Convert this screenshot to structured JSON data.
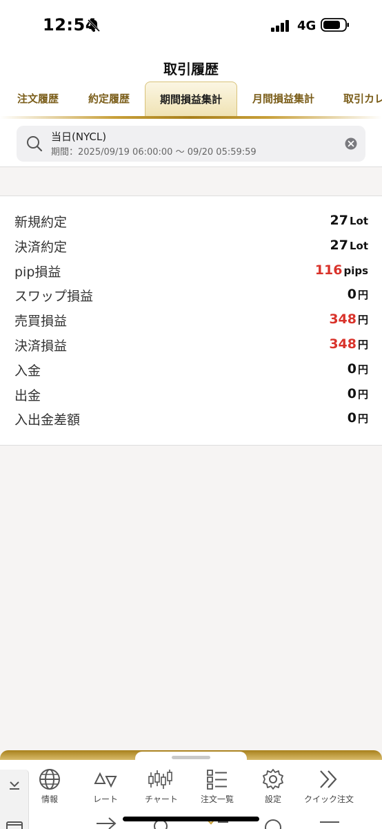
{
  "status_bar": {
    "time": "12:54",
    "network": "4G"
  },
  "header": {
    "title": "取引履歴",
    "tabs": [
      {
        "label": "注文履歴"
      },
      {
        "label": "約定履歴"
      },
      {
        "label": "期間損益集計"
      },
      {
        "label": "月間損益集計"
      },
      {
        "label": "取引カレ"
      }
    ],
    "active_tab": "期間損益集計"
  },
  "search": {
    "title": "当日(NYCL)",
    "period": "期間：2025/09/19 06:00:00 ～ 09/20 05:59:59"
  },
  "summary": {
    "rows": [
      {
        "label": "新規約定",
        "value": "27",
        "unit": "Lot",
        "highlight": false
      },
      {
        "label": "決済約定",
        "value": "27",
        "unit": "Lot",
        "highlight": false
      },
      {
        "label": "pip損益",
        "value": "116",
        "unit": "pips",
        "highlight": true
      },
      {
        "label": "スワップ損益",
        "value": "0",
        "unit": "円",
        "highlight": false
      },
      {
        "label": "売買損益",
        "value": "348",
        "unit": "円",
        "highlight": true
      },
      {
        "label": "決済損益",
        "value": "348",
        "unit": "円",
        "highlight": true
      },
      {
        "label": "入金",
        "value": "0",
        "unit": "円",
        "highlight": false
      },
      {
        "label": "出金",
        "value": "0",
        "unit": "円",
        "highlight": false
      },
      {
        "label": "入出金差額",
        "value": "0",
        "unit": "円",
        "highlight": false
      }
    ]
  },
  "bottom_nav": {
    "items": [
      {
        "label": "情報",
        "icon": "globe-icon"
      },
      {
        "label": "レート",
        "icon": "rate-triangles-icon"
      },
      {
        "label": "チャート",
        "icon": "candlestick-icon"
      },
      {
        "label": "注文一覧",
        "icon": "order-list-icon"
      },
      {
        "label": "設定",
        "icon": "gear-icon"
      },
      {
        "label": "クイック注文",
        "icon": "double-chevron-icon"
      }
    ]
  },
  "colors": {
    "gold": "#b8912c",
    "profit_red": "#d9332b",
    "tab_text": "#7a5d19"
  }
}
